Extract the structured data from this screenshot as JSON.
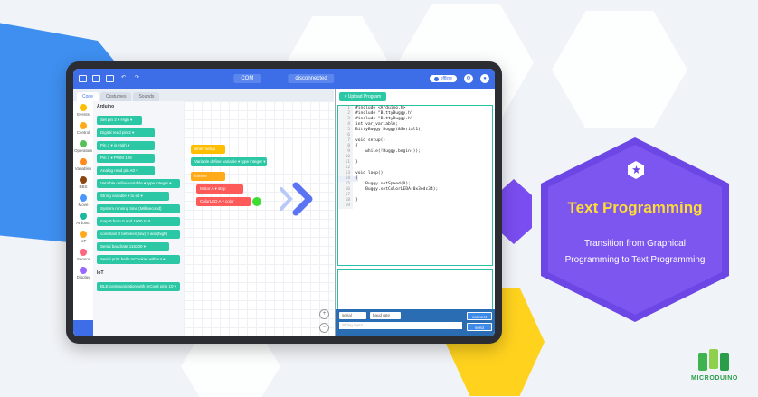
{
  "topbar": {
    "port": "COM",
    "status": "disconnected",
    "mode": "offline"
  },
  "tabs": [
    {
      "label": "Code"
    },
    {
      "label": "Costumes"
    },
    {
      "label": "Sounds"
    }
  ],
  "categories": [
    {
      "label": "Events",
      "color": "#ffbf00"
    },
    {
      "label": "Control",
      "color": "#ffab19"
    },
    {
      "label": "Operators",
      "color": "#59c059"
    },
    {
      "label": "Variables",
      "color": "#ff8c1a"
    },
    {
      "label": "BBS",
      "color": "#8b4513"
    },
    {
      "label": "Move",
      "color": "#4c97ff"
    },
    {
      "label": "Arduino",
      "color": "#1cb8a0"
    },
    {
      "label": "IoT",
      "color": "#ffab19"
    },
    {
      "label": "Sensor",
      "color": "#ff6680"
    },
    {
      "label": "Display",
      "color": "#9966ff"
    }
  ],
  "palette": {
    "head": "Arduino",
    "blocks": [
      "Set pin 2 ▾ High ▾",
      "Digital read pin 2 ▾",
      "Pin 3 ▾ is High ▾",
      "Pin 3 ▾ PWM 128",
      "Analog read pin A0 ▾",
      "Variable define variable ▾ type integer ▾",
      "String variable ▾ to int ▾",
      "System running time (Millisecond)",
      "map 0 from 0 and 1000 to 0",
      "constrain 0 between(low) 0 and(high)",
      "Serial baudrate 115200 ▾",
      "Serial print hello mCookie! without ▾"
    ],
    "head2": "IoT",
    "iot_blocks": [
      "BLE communication with mCook pins 10 ▾"
    ]
  },
  "workspace": {
    "setup_label": "when setup",
    "define_label": "Variable define variable ▾ type integer ▾",
    "forever_label": "forever",
    "motor_label": "Motor A ▾ stop",
    "led_label": "ColorLED A ▾ color"
  },
  "right": {
    "upload_label": "▾ Upload Program",
    "code_lines": [
      "#include <Arduino.h>",
      "#include \"BittyBuggy.h\"",
      "#include \"BittyBuggy.h\"",
      "int var_variable;",
      "BittyBuggy Buggy(&Serial1);",
      "",
      "void setup()",
      "{",
      "    while(!Buggy.begin());",
      "",
      "}",
      "",
      "void loop()",
      "{",
      "    Buggy.setSpeed(0);",
      "    Buggy.setColorLEDA(0x3edc34);",
      "",
      "}",
      ""
    ],
    "serial_label": "serial",
    "baud_label": "baud rate",
    "string_placeholder": "String input",
    "connect_label": "connect",
    "send_label": "send"
  },
  "badge": {
    "title": "Text Programming",
    "subtitle_line1": "Transition from Graphical",
    "subtitle_line2": "Programming to Text Programming"
  },
  "logo": {
    "text": "MICRODUINO"
  },
  "colors": {
    "app_blue": "#3d6ee8",
    "block_teal": "#2cc8a5",
    "badge_purple": "#6c47e5",
    "title_yellow": "#ffdd33",
    "logo_green": "#2a9d4a"
  }
}
